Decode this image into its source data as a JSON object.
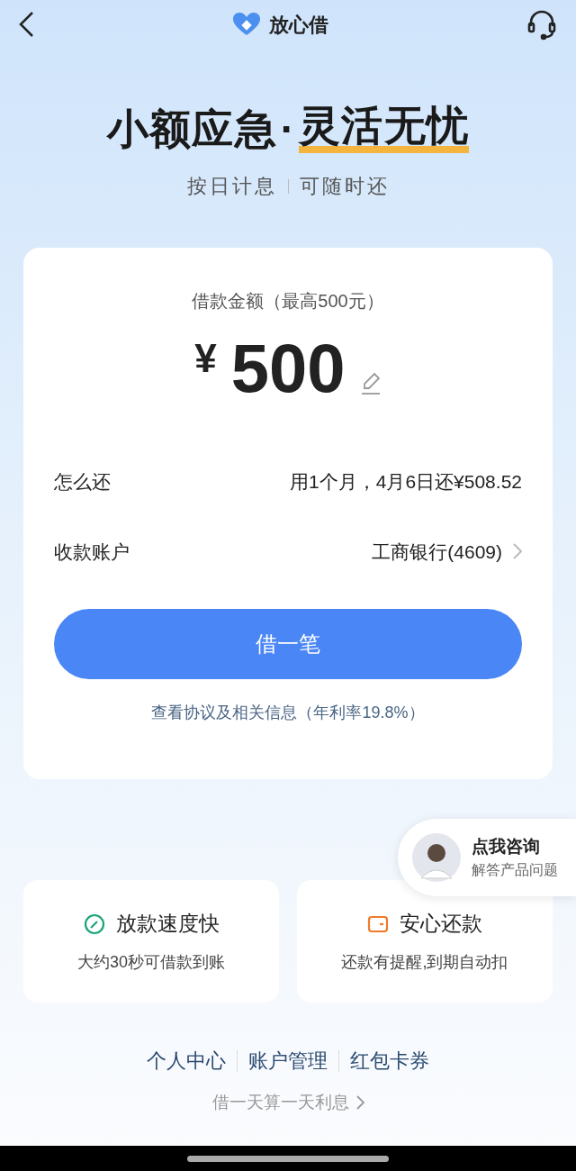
{
  "header": {
    "title": "放心借"
  },
  "hero": {
    "headline_left": "小额应急",
    "separator": "·",
    "headline_right": "灵活无忧",
    "tags": [
      "按日计息",
      "可随时还"
    ]
  },
  "loan_card": {
    "amount_label": "借款金额（最高500元）",
    "currency": "¥",
    "amount": "500",
    "rows": [
      {
        "label": "怎么还",
        "value": "用1个月，4月6日还¥508.52",
        "has_arrow": false
      },
      {
        "label": "收款账户",
        "value": "工商银行(4609)",
        "has_arrow": true
      }
    ],
    "button": "借一笔",
    "agreement_link": "查看协议及相关信息（年利率19.8%）"
  },
  "consult": {
    "title": "点我咨询",
    "subtitle": "解答产品问题"
  },
  "features": [
    {
      "kind": "speed",
      "title": "放款速度快",
      "desc": "大约30秒可借款到账"
    },
    {
      "kind": "wallet",
      "title": "安心还款",
      "desc": "还款有提醒,到期自动扣"
    }
  ],
  "footer_links": [
    "个人中心",
    "账户管理",
    "红包卡券"
  ],
  "footer_note": "借一天算一天利息"
}
